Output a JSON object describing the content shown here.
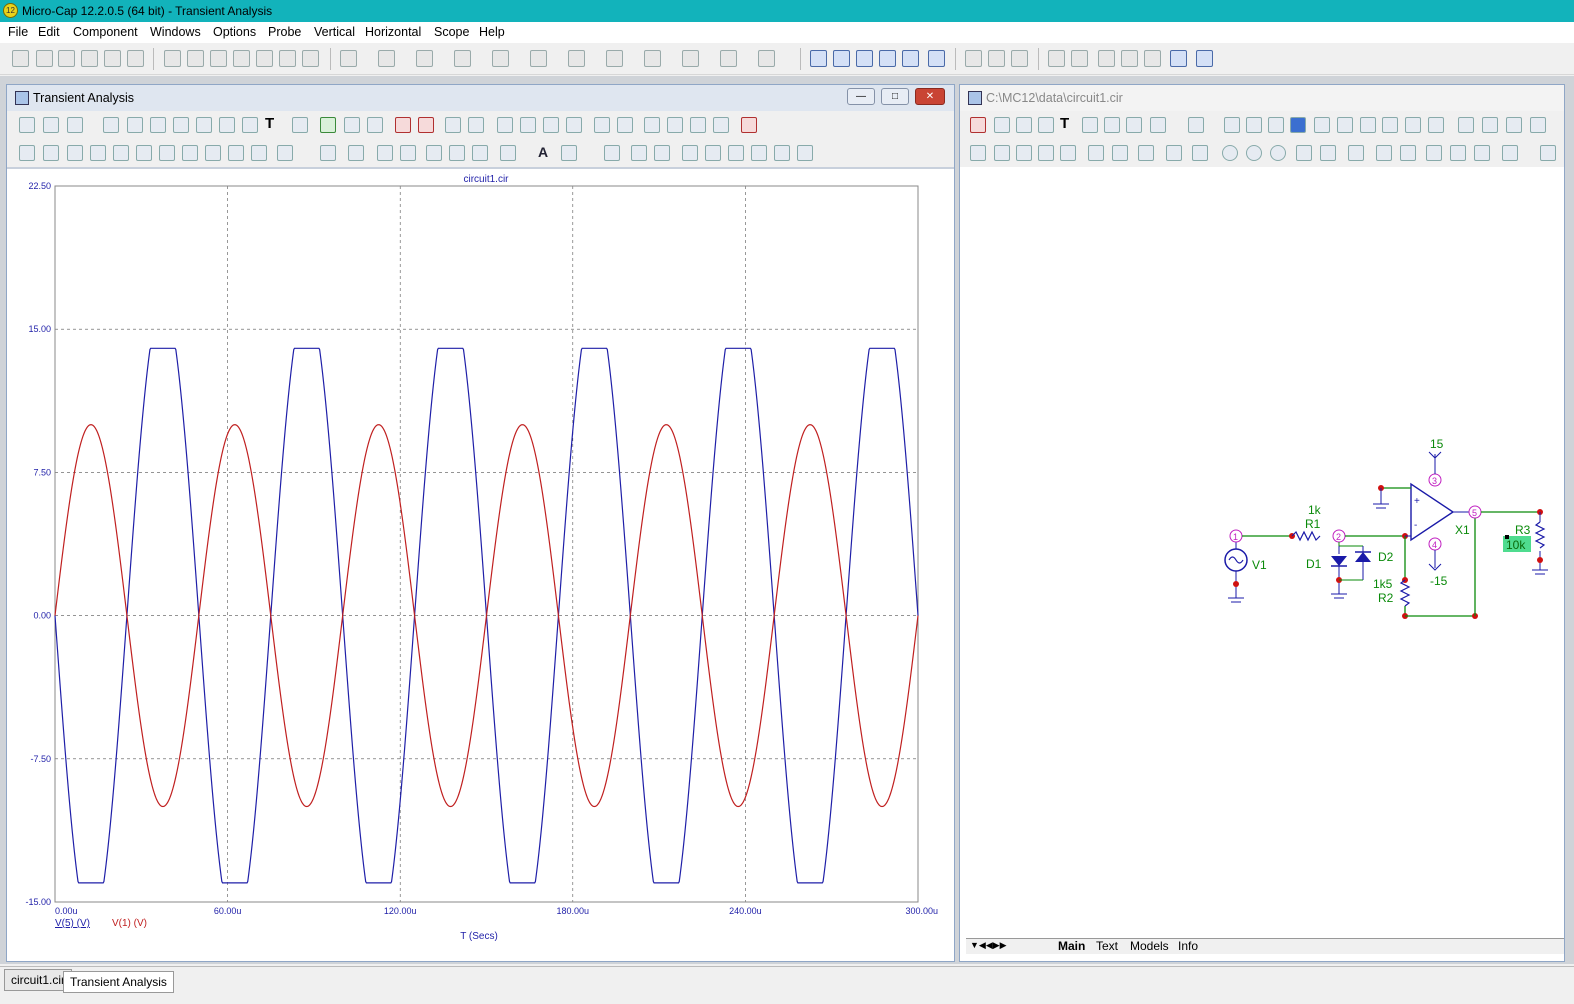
{
  "app": {
    "title": "Micro-Cap 12.2.0.5 (64 bit) - Transient Analysis",
    "icon_label": "12"
  },
  "menu": [
    "File",
    "Edit",
    "Component",
    "Windows",
    "Options",
    "Probe",
    "Vertical",
    "Horizontal",
    "Scope",
    "Help"
  ],
  "analysis_window": {
    "title": "Transient Analysis",
    "plot_title": "circuit1.cir",
    "xlabel": "T (Secs)",
    "legend": [
      {
        "label": "V(5) (V)",
        "color": "#1f1fa8"
      },
      {
        "label": "V(1) (V)",
        "color": "#c02020"
      }
    ]
  },
  "chart_data": {
    "type": "line",
    "title": "circuit1.cir",
    "xlabel": "T (Secs)",
    "ylabel": "",
    "xlim": [
      0,
      300
    ],
    "ylim": [
      -15,
      22.5
    ],
    "x_ticks": [
      "0.00u",
      "60.00u",
      "120.00u",
      "180.00u",
      "240.00u",
      "300.00u"
    ],
    "y_ticks": [
      "22.50",
      "15.00",
      "7.50",
      "0.00",
      "-7.50",
      "-15.00"
    ],
    "grid": true,
    "series": [
      {
        "name": "V(5) (V)",
        "color": "#1f1fa8",
        "amplitude": 14,
        "period_us": 50,
        "clip_at": 14,
        "phase": "inverted"
      },
      {
        "name": "V(1) (V)",
        "color": "#c02020",
        "amplitude": 10,
        "period_us": 50,
        "phase": "normal"
      }
    ]
  },
  "schematic_window": {
    "title": "C:\\MC12\\data\\circuit1.cir",
    "tabs": [
      "Main",
      "Text",
      "Models",
      "Info"
    ],
    "labels": {
      "vplus": "15",
      "vminus": "-15",
      "r1_value": "1k",
      "r1_name": "R1",
      "d1": "D1",
      "d2": "D2",
      "r2_value": "1k5",
      "r2_name": "R2",
      "x1": "X1",
      "r3_name": "R3",
      "r3_value": "10k",
      "v1": "V1",
      "n1": "1",
      "n2": "2",
      "n3": "3",
      "n4": "4",
      "n5": "5"
    }
  },
  "bottom_tabs": [
    "circuit1.cir",
    "Transient Analysis"
  ]
}
